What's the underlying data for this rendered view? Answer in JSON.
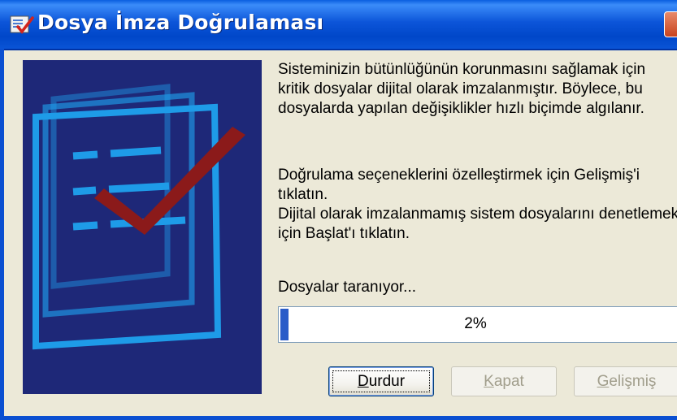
{
  "window": {
    "title": "Dosya İmza Doğrulaması",
    "title_icon": "signature-verification-icon"
  },
  "content": {
    "paragraph1_lines": [
      "Sisteminizin bütünlüğünün korunmasını sağlamak için",
      "kritik dosyalar dijital olarak imzalanmıştır. Böylece, bu",
      "dosyalarda yapılan değişiklikler hızlı biçimde algılanır."
    ],
    "paragraph2_lines": [
      "Doğrulama seçeneklerini özelleştirmek için Gelişmiş'i",
      "tıklatın.",
      "Dijital olarak imzalanmamış sistem dosyalarını denetlemek",
      "için Başlat'ı tıklatın."
    ],
    "status": "Dosyalar taranıyor...",
    "progress": {
      "percent": 2,
      "label": "2%"
    },
    "illustration": "document-checkmark-illustration"
  },
  "buttons": {
    "stop": {
      "label_mnemonic": "D",
      "label_rest": "urdur"
    },
    "close": {
      "label_mnemonic": "K",
      "label_rest": "apat"
    },
    "advanced": {
      "label_mnemonic": "G",
      "label_rest": "elişmiş"
    }
  },
  "colors": {
    "titlebar": "#0C55D9",
    "illustration_bg": "#1E2878",
    "document_lines": "#1E9BE8",
    "checkmark": "#8B1A1A",
    "progress_fill": "#2A5CC8",
    "dialog_bg": "#ECE9D8"
  }
}
